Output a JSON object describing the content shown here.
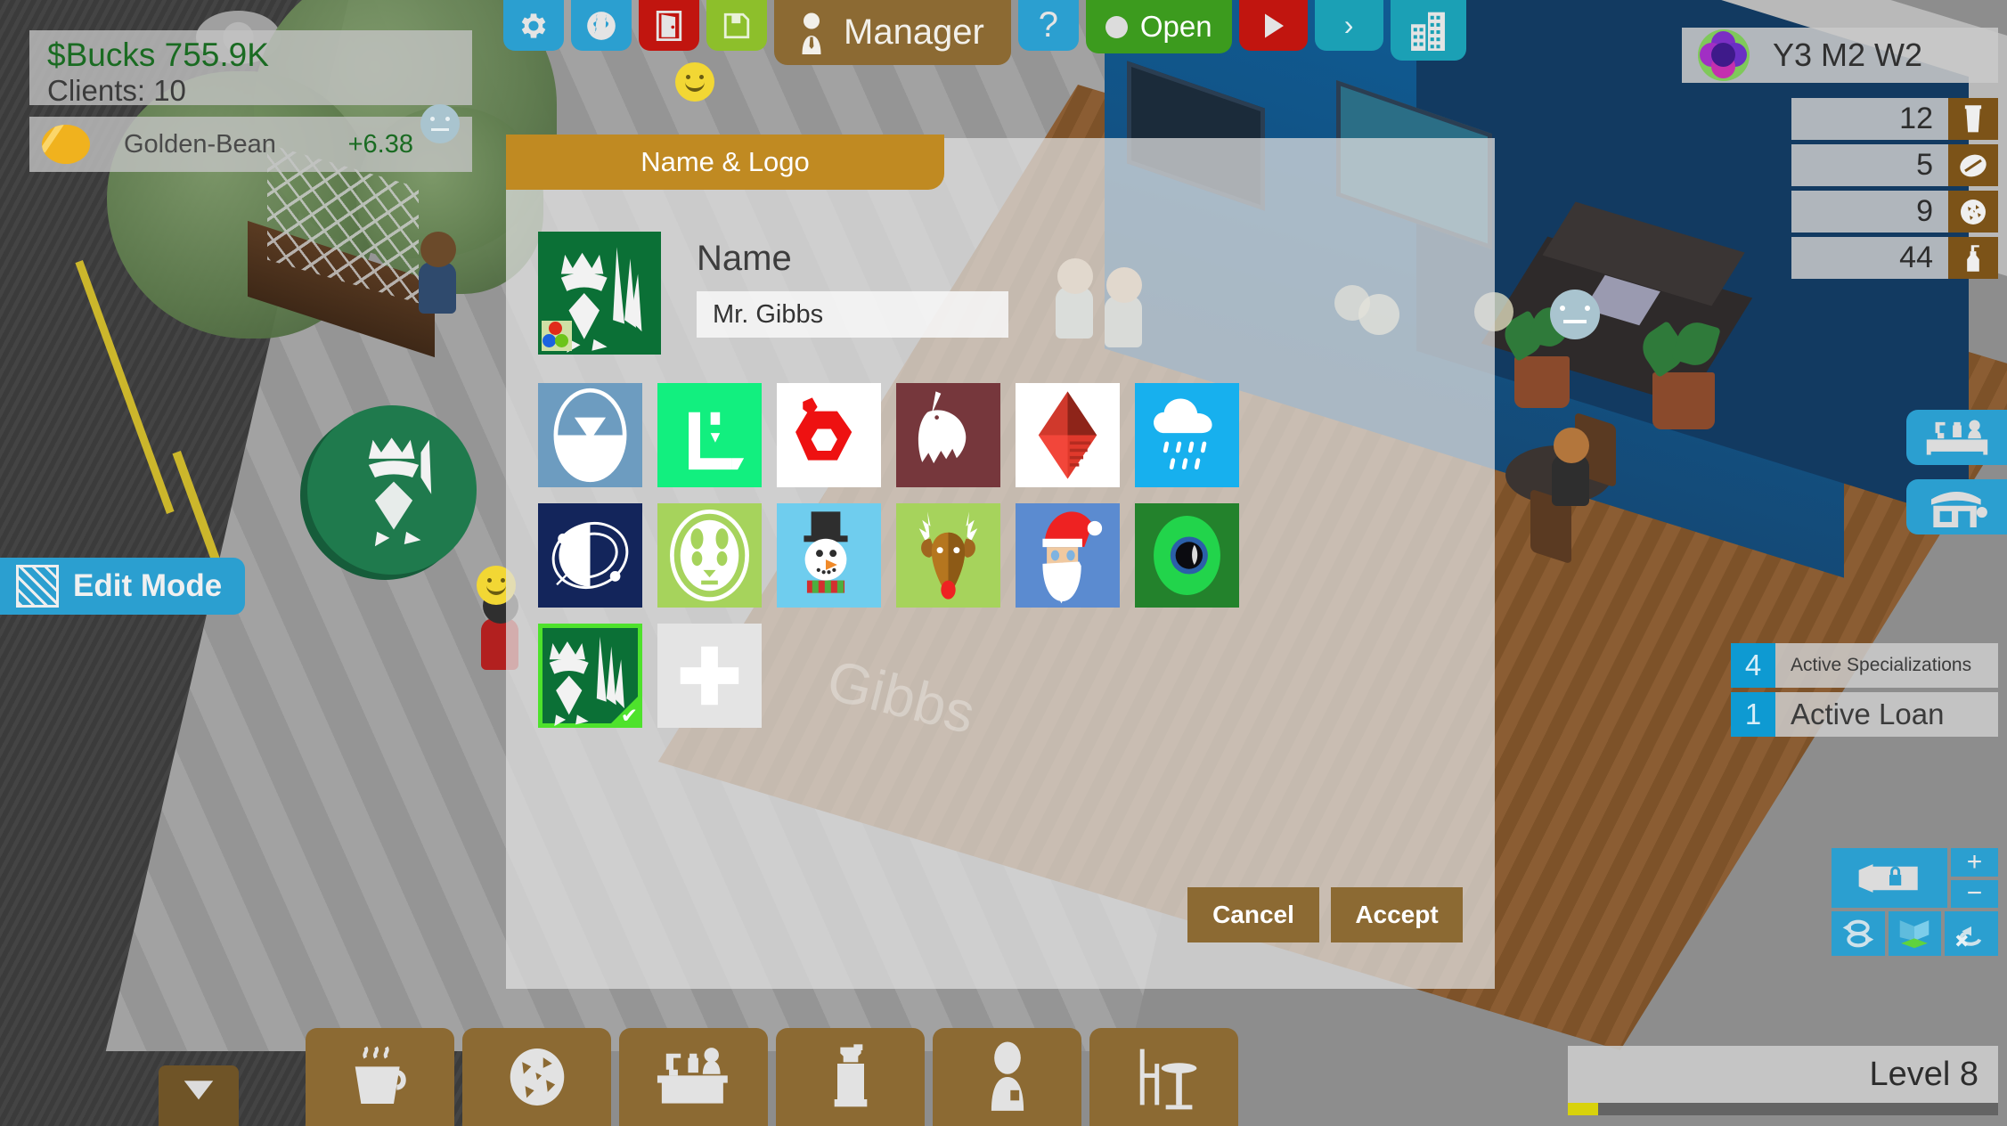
{
  "hud": {
    "money_label": "$Bucks 755.9K",
    "clients_label": "Clients: 10",
    "brand_name": "Golden-Bean",
    "brand_delta": "+6.38",
    "bean_icon": "coffee-bean-icon",
    "mood_icon": "neutral-face-icon"
  },
  "topbar": {
    "buttons": [
      {
        "name": "settings-button",
        "icon": "gear-icon",
        "color": "#2b9fd0"
      },
      {
        "name": "world-button",
        "icon": "globe-icon",
        "color": "#2b9fd0"
      },
      {
        "name": "exit-button",
        "icon": "door-icon",
        "color": "#c1150f"
      },
      {
        "name": "save-button",
        "icon": "floppy-disk-icon",
        "color": "#8dbf2b"
      }
    ],
    "manager_label": "Manager",
    "manager_icon": "person-icon",
    "help_label": "?",
    "open_label": "Open",
    "open_icon": "circle-dot-icon",
    "play_icon": "play-icon",
    "forward_label": "›",
    "city_icon": "city-buildings-icon"
  },
  "right_panel": {
    "date_label": "Y3 M2 W2",
    "date_icon": "flower-icon",
    "stats": [
      {
        "value": "12",
        "icon": "cup-icon"
      },
      {
        "value": "5",
        "icon": "coffee-bean-icon"
      },
      {
        "value": "9",
        "icon": "cookie-icon"
      },
      {
        "value": "44",
        "icon": "syrup-bottle-icon"
      }
    ],
    "specializations": [
      {
        "count": "4",
        "label": "Active Specializations"
      },
      {
        "count": "1",
        "label": "Active Loan"
      }
    ],
    "side_buttons": [
      {
        "name": "counter-view-button",
        "icon": "bar-counter-icon"
      },
      {
        "name": "storefront-button",
        "icon": "storefront-icon"
      }
    ],
    "camera": {
      "lock_icon": "camera-lock-icon",
      "zoom_in_label": "+",
      "zoom_out_label": "−",
      "rotate_icon": "rotate-icon",
      "wall_icon": "wall-view-icon",
      "reset_rotate_icon": "reset-rotate-icon"
    },
    "level_label": "Level 8",
    "level_progress_percent": 7
  },
  "edit_mode": {
    "label": "Edit Mode",
    "icon": "hatch-grid-icon"
  },
  "bottombar": {
    "buttons": [
      {
        "name": "drinks-button",
        "icon": "coffee-cup-icon"
      },
      {
        "name": "food-button",
        "icon": "cookie-icon"
      },
      {
        "name": "equipment-button",
        "icon": "bar-counter-icon"
      },
      {
        "name": "grinder-button",
        "icon": "grinder-icon"
      },
      {
        "name": "staff-button",
        "icon": "person-icon"
      },
      {
        "name": "furniture-button",
        "icon": "table-chair-icon"
      }
    ],
    "extra_button": {
      "name": "collapse-button",
      "icon": "triangle-down-icon"
    }
  },
  "dialog": {
    "title": "Name & Logo",
    "name_label": "Name",
    "name_value": "Mr. Gibbs",
    "name_placeholder": "Name",
    "current_logo_icon": "king-hops-logo-icon",
    "cancel_label": "Cancel",
    "accept_label": "Accept",
    "watermark_text": "Gibbs",
    "logos": [
      {
        "name": "logo-pill-arrow",
        "icon": "pill-down-arrow-icon",
        "bg": "#6d9cc0",
        "selected": false
      },
      {
        "name": "logo-faucet",
        "icon": "faucet-drip-icon",
        "bg": "#12ef7f",
        "selected": false
      },
      {
        "name": "logo-hex-ring",
        "icon": "red-hexagon-icon",
        "bg": "#ffffff",
        "selected": false
      },
      {
        "name": "logo-unicorn",
        "icon": "unicorn-icon",
        "bg": "#76373c",
        "selected": false
      },
      {
        "name": "logo-diamond",
        "icon": "red-diamond-icon",
        "bg": "#ffffff",
        "selected": false
      },
      {
        "name": "logo-rain-cloud",
        "icon": "rain-cloud-icon",
        "bg": "#17b0ee",
        "selected": false
      },
      {
        "name": "logo-orbit",
        "icon": "orbit-moon-icon",
        "bg": "#13255b",
        "selected": false
      },
      {
        "name": "logo-panda",
        "icon": "panda-face-icon",
        "bg": "#a6d35c",
        "selected": false
      },
      {
        "name": "logo-snowman",
        "icon": "snowman-icon",
        "bg": "#6fcdee",
        "selected": false
      },
      {
        "name": "logo-reindeer",
        "icon": "reindeer-icon",
        "bg": "#a6d35c",
        "selected": false
      },
      {
        "name": "logo-santa",
        "icon": "santa-icon",
        "bg": "#5b8bd0",
        "selected": false
      },
      {
        "name": "logo-eye",
        "icon": "eye-icon",
        "bg": "#23822c",
        "selected": false
      },
      {
        "name": "logo-king-hops",
        "icon": "king-hops-logo-icon",
        "bg": "#0b7036",
        "selected": true
      },
      {
        "name": "logo-add-new",
        "icon": "plus-icon",
        "bg": "#e4e4e4",
        "selected": false
      }
    ]
  },
  "colors": {
    "accent_blue": "#2b9fd0",
    "brown": "#8c6a33",
    "header_gold": "#c08a22",
    "open_green": "#3c9b1e",
    "danger_red": "#c1150f",
    "level_yellow": "#d8d20c",
    "select_green": "#4ee22c"
  }
}
